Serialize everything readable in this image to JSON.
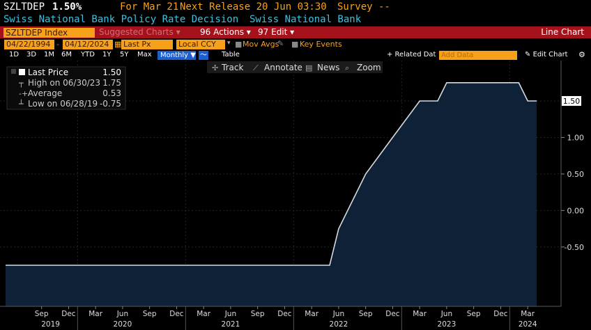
{
  "header": {
    "ticker": "SZLTDEP",
    "value": "1.50%",
    "for_label": "For Mar 21",
    "next_release": "Next Release 20 Jun 03:30",
    "survey": "Survey --",
    "title": "Swiss National Bank Policy Rate Decision",
    "source": "Swiss National Bank"
  },
  "toolbar": {
    "index_field": "SZLTDEP Index",
    "suggested_charts": "Suggested Charts",
    "actions": "Actions",
    "actions_num": "96",
    "edit": "Edit",
    "edit_num": "97",
    "line_chart": "Line Chart"
  },
  "range_row": {
    "start_date": "04/22/1994",
    "end_date": "04/12/2024",
    "price_type": "Last Px",
    "currency": "Local CCY",
    "mov_avgs": "Mov Avgs",
    "key_events": "Key Events"
  },
  "period_row": {
    "periods": [
      "1D",
      "3D",
      "1M",
      "6M",
      "YTD",
      "1Y",
      "5Y",
      "Max"
    ],
    "frequency": "Monthly",
    "table": "Table",
    "related_data": "+ Related Dat",
    "add_data_placeholder": "Add Data",
    "edit_chart": "Edit Chart"
  },
  "tools": {
    "track": "Track",
    "annotate": "Annotate",
    "news": "News",
    "zoom": "Zoom"
  },
  "legend": {
    "last_price_label": "Last Price",
    "last_price": "1.50",
    "high_label": "High on 06/30/23",
    "high": "1.75",
    "average_label": "Average",
    "average": "0.53",
    "low_label": "Low on 06/28/19",
    "low": "-0.75"
  },
  "colors": {
    "fill": "#0f2136",
    "line": "#d7dce2",
    "accent_orange": "#f7a11b",
    "title_cyan": "#39c2e0",
    "toolbar_red": "#a5121c",
    "active_blue": "#1d5fd1"
  },
  "chart_data": {
    "type": "area",
    "series": [
      {
        "values": [
          {
            "x": "2019-05",
            "y": -0.75
          },
          {
            "x": "2022-05",
            "y": -0.75
          },
          {
            "x": "2022-06",
            "y": -0.25
          },
          {
            "x": "2022-09",
            "y": 0.5
          },
          {
            "x": "2022-12",
            "y": 1.0
          },
          {
            "x": "2023-03",
            "y": 1.5
          },
          {
            "x": "2023-05",
            "y": 1.5
          },
          {
            "x": "2023-06",
            "y": 1.75
          },
          {
            "x": "2023-12",
            "y": 1.75
          },
          {
            "x": "2024-02",
            "y": 1.75
          },
          {
            "x": "2024-03",
            "y": 1.5
          },
          {
            "x": "2024-04",
            "y": 1.5
          }
        ]
      }
    ],
    "x_tick_labels": [
      "Sep",
      "Dec",
      "Mar",
      "Jun",
      "Sep",
      "Dec",
      "Mar",
      "Jun",
      "Sep",
      "Dec",
      "Mar",
      "Jun",
      "Sep",
      "Dec",
      "Mar",
      "Jun",
      "Sep",
      "Dec",
      "Mar"
    ],
    "x_tick_dates": [
      "2019-09",
      "2019-12",
      "2020-03",
      "2020-06",
      "2020-09",
      "2020-12",
      "2021-03",
      "2021-06",
      "2021-09",
      "2021-12",
      "2022-03",
      "2022-06",
      "2022-09",
      "2022-12",
      "2023-03",
      "2023-06",
      "2023-09",
      "2023-12",
      "2024-03"
    ],
    "year_labels": [
      "2019",
      "2020",
      "2021",
      "2022",
      "2023",
      "2024"
    ],
    "year_dates": [
      "2019-10",
      "2020-06",
      "2021-06",
      "2022-06",
      "2023-06",
      "2024-03"
    ],
    "y_ticks": [
      "1.00",
      "0.50",
      "0.00",
      "-0.50"
    ],
    "y_tick_values": [
      1.0,
      0.5,
      0.0,
      -0.5
    ],
    "last_value_label": "1.50",
    "ylim": [
      -1.0,
      2.0
    ],
    "xlim": [
      "2019-05",
      "2024-05"
    ],
    "grid": true
  }
}
